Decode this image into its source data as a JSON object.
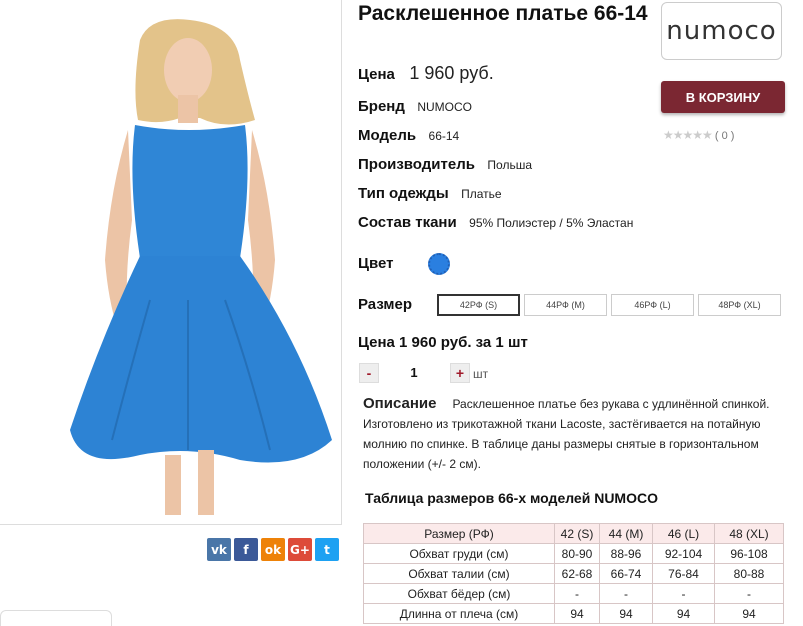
{
  "product": {
    "title": "Расклешенное платье 66-14",
    "price_label": "Цена",
    "price_value": "1 960 руб.",
    "details": [
      {
        "label": "Бренд",
        "value": "NUMOCO"
      },
      {
        "label": "Модель",
        "value": "66-14"
      },
      {
        "label": "Производитель",
        "value": "Польша"
      },
      {
        "label": "Тип одежды",
        "value": "Платье"
      },
      {
        "label": "Состав ткани",
        "value": "95% Полиэстер / 5% Эластан"
      }
    ],
    "color_label": "Цвет",
    "color_hex": "#2a7fe0",
    "size_label": "Размер",
    "sizes": [
      "42РФ (S)",
      "44РФ (M)",
      "46РФ (L)",
      "48РФ (XL)"
    ],
    "selected_size": "42РФ (S)",
    "total_text": "Цена 1 960 руб. за 1 шт",
    "quantity": "1",
    "minus": "-",
    "plus": "+",
    "unit": "шт"
  },
  "brand_logo": "numoco",
  "cart_button": "В КОРЗИНУ",
  "rating": {
    "stars": "★★★★★",
    "count": "( 0 )"
  },
  "description": {
    "label": "Описание",
    "text": "Расклешенное платье без рукава с удлинённой спинкой. Изготовлено из трикотажной ткани Lacoste, застёгивается на потайную молнию по спинке. В таблице даны размеры снятые в горизонтальном положении (+/- 2 см)."
  },
  "social": [
    {
      "name": "vk-icon",
      "glyph": "vk",
      "color": "#4a76a8"
    },
    {
      "name": "facebook-icon",
      "glyph": "f",
      "color": "#3b5998"
    },
    {
      "name": "odnoklassniki-icon",
      "glyph": "ok",
      "color": "#ee8208"
    },
    {
      "name": "googleplus-icon",
      "glyph": "G+",
      "color": "#dd4b39"
    },
    {
      "name": "twitter-icon",
      "glyph": "t",
      "color": "#1da1f2"
    }
  ],
  "size_table": {
    "title": "Таблица размеров 66-х моделей NUMOCO",
    "header": [
      "Размер (РФ)",
      "42 (S)",
      "44 (M)",
      "46 (L)",
      "48 (XL)"
    ],
    "rows": [
      [
        "Обхват груди (см)",
        "80-90",
        "88-96",
        "92-104",
        "96-108"
      ],
      [
        "Обхват талии (см)",
        "62-68",
        "66-74",
        "76-84",
        "80-88"
      ],
      [
        "Обхват бёдер (см)",
        "-",
        "-",
        "-",
        "-"
      ],
      [
        "Длинна от плеча (см)",
        "94",
        "94",
        "94",
        "94"
      ]
    ]
  }
}
